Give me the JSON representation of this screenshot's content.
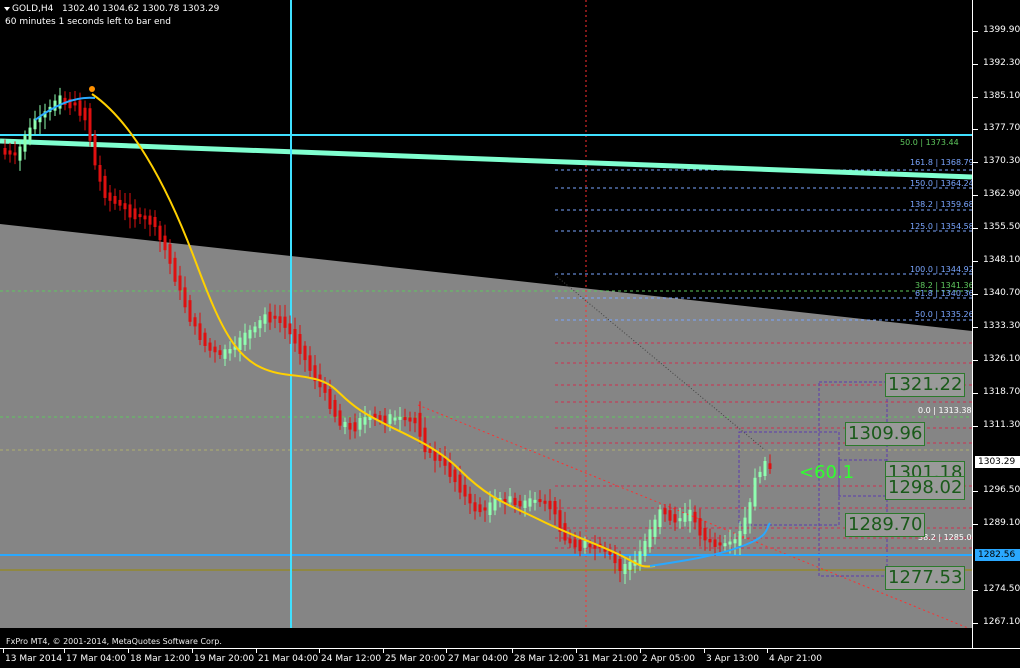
{
  "header": {
    "symbol": "GOLD,H4",
    "ohlc": "1302.40 1304.62 1300.78 1303.29",
    "countdown": "60 minutes 1 seconds left to bar end"
  },
  "y_axis_labels": [
    "1399.90",
    "1392.30",
    "1385.10",
    "1377.70",
    "1370.30",
    "1362.90",
    "1355.50",
    "1348.10",
    "1340.70",
    "1333.30",
    "1326.10",
    "1318.70",
    "1311.30",
    "1303.29",
    "1296.50",
    "1289.10",
    "1282.56",
    "1274.50",
    "1267.10"
  ],
  "x_axis_labels": [
    "13 Mar 2014",
    "17 Mar 04:00",
    "18 Mar 12:00",
    "19 Mar 20:00",
    "21 Mar 04:00",
    "24 Mar 12:00",
    "25 Mar 20:00",
    "27 Mar 04:00",
    "28 Mar 12:00",
    "31 Mar 21:00",
    "2 Apr 05:00",
    "3 Apr 13:00",
    "4 Apr 21:00"
  ],
  "fib_upper": [
    {
      "label": "50.0 | 1373.44",
      "color": "#5ec85e"
    },
    {
      "label": "161.8 | 1368.79",
      "color": "#7aa6ff"
    },
    {
      "label": "150.0 | 1364.24",
      "color": "#7aa6ff"
    },
    {
      "label": "138.2 | 1359.68",
      "color": "#7aa6ff"
    },
    {
      "label": "125.0 | 1354.58",
      "color": "#7aa6ff"
    },
    {
      "label": "100.0 | 1344.92",
      "color": "#7aa6ff"
    },
    {
      "label": "38.2 | 1341.36",
      "color": "#5ec85e"
    },
    {
      "label": "61.8 | 1340.36",
      "color": "#7aa6ff"
    },
    {
      "label": "50.0 | 1335.26",
      "color": "#7aa6ff"
    },
    {
      "label": "0.0 | 1313.38",
      "color": "#ffffff"
    },
    {
      "label": "38.2 | 1285.03",
      "color": "#ffffff"
    }
  ],
  "big_labels": [
    "1321.22",
    "1309.96",
    "1301.18",
    "1298.02",
    "1289.70",
    "1277.53"
  ],
  "annotation": "<60.1",
  "price_tags": {
    "current": "1303.29",
    "line": "1282.56"
  },
  "copyright": "FxPro MT4, © 2001-2014, MetaQuotes Software Corp.",
  "colors": {
    "bg_dark": "#000000",
    "bg_gray": "#858585",
    "candle_up": "#8fffb0",
    "candle_down": "#e01010",
    "ma": "#ffd000",
    "fast_ma": "#2aa8ff",
    "vline": "#40e0ff",
    "trend_thick": "#80ffd0"
  }
}
